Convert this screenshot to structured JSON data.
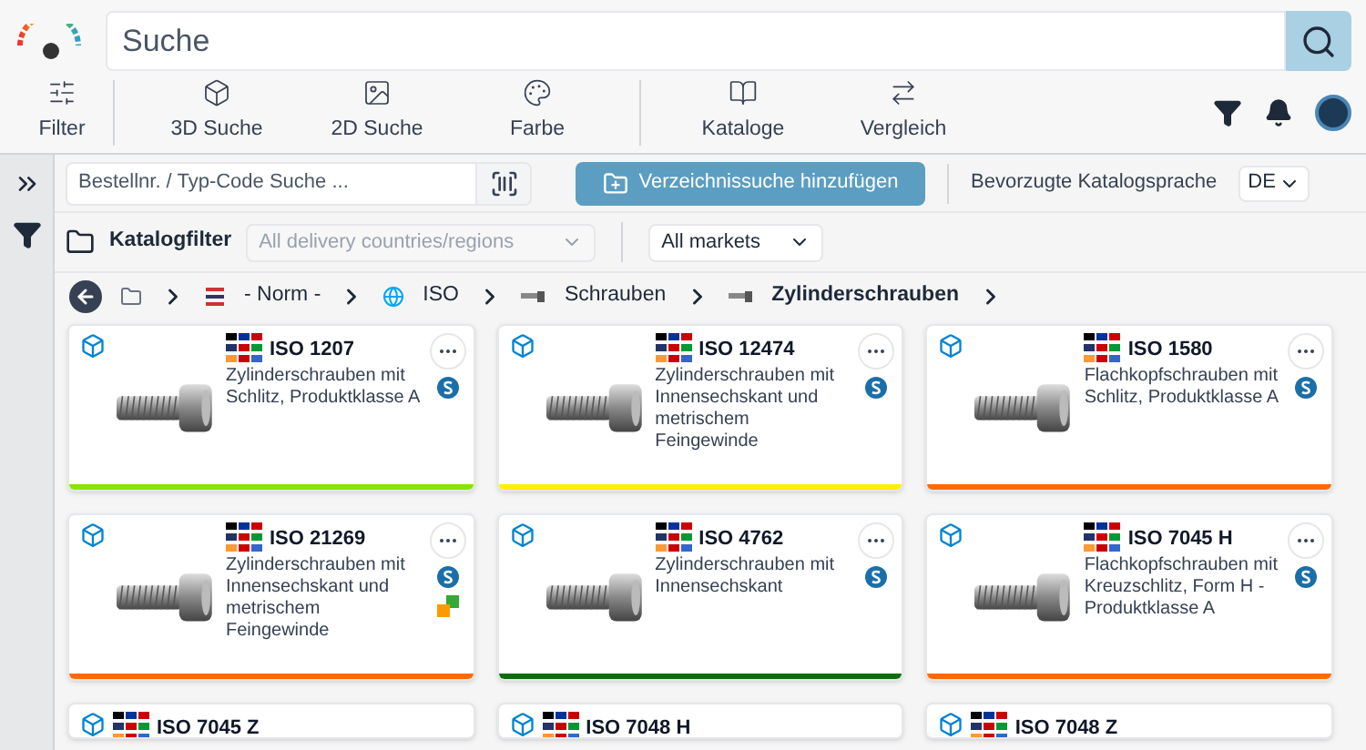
{
  "search": {
    "placeholder": "Suche"
  },
  "toolbar": [
    {
      "label": "Filter"
    },
    {
      "label": "3D Suche"
    },
    {
      "label": "2D Suche"
    },
    {
      "label": "Farbe"
    },
    {
      "label": "Kataloge"
    },
    {
      "label": "Vergleich"
    }
  ],
  "code_search": {
    "placeholder": "Bestellnr. / Typ-Code Suche ..."
  },
  "add_button": "Verzeichnissuche hinzufügen",
  "language": {
    "label": "Bevorzugte Katalogsprache",
    "value": "DE"
  },
  "catalog_filter": {
    "label": "Katalogfilter",
    "countries": "All delivery countries/regions",
    "countries_disabled": true,
    "markets": "All markets"
  },
  "breadcrumb": [
    {
      "label": "- Norm -",
      "current": false
    },
    {
      "label": "ISO",
      "current": false
    },
    {
      "label": "Schrauben",
      "current": false
    },
    {
      "label": "Zylinderschrauben",
      "current": true
    }
  ],
  "cards": [
    {
      "title": "ISO 1207",
      "description": "Zylinderschrauben mit Schlitz, Produktklasse A",
      "color": "#88e400",
      "variants": false
    },
    {
      "title": "ISO 12474",
      "description": "Zylinderschrauben mit Innensechskant und metrischem Feingewinde",
      "color": "#ffee00",
      "variants": false
    },
    {
      "title": "ISO 1580",
      "description": "Flachkopfschrauben mit Schlitz, Produktklasse A",
      "color": "#ff6a00",
      "variants": false
    },
    {
      "title": "ISO 21269",
      "description": "Zylinderschrauben mit Innensechskant und metrischem Feingewinde",
      "color": "#ff6a00",
      "variants": true
    },
    {
      "title": "ISO 4762",
      "description": "Zylinderschrauben mit Innensechskant",
      "color": "#0a6e0a",
      "variants": false
    },
    {
      "title": "ISO 7045 H",
      "description": "Flachkopfschrauben mit Kreuzschlitz, Form H - Produktklasse A",
      "color": "#ff6a00",
      "variants": false
    },
    {
      "title": "ISO 7045 Z"
    },
    {
      "title": "ISO 7048 H"
    },
    {
      "title": "ISO 7048 Z"
    }
  ]
}
